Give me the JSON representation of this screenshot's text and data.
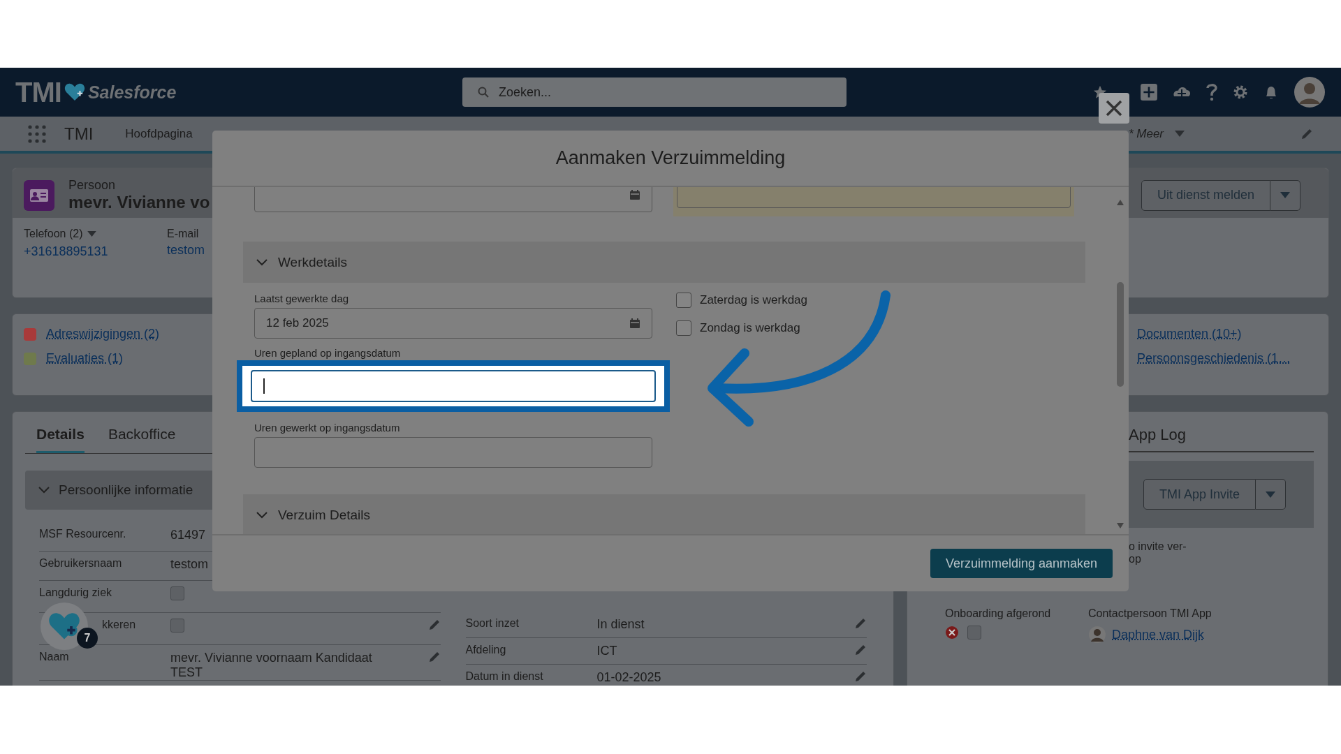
{
  "header": {
    "logo": "TMI",
    "brand": "Salesforce",
    "search": {
      "placeholder": "Zoeken..."
    }
  },
  "nav": {
    "app_name": "TMI",
    "items": [
      {
        "label": "Hoofdpagina"
      }
    ],
    "more": "* Meer"
  },
  "record": {
    "type": "Persoon",
    "name": "mevr. Vivianne vo",
    "phone_label": "Telefoon (2)",
    "phone": "+31618895131",
    "email_label": "E-mail",
    "email": "testom",
    "action": "Uit dienst melden"
  },
  "related_left": [
    {
      "label": "Adreswijzigingen (2)",
      "color": "#a83a3a"
    },
    {
      "label": "Evaluaties (1)",
      "color": "#6f7a4c"
    }
  ],
  "related_right": [
    {
      "label": "Documenten (10+)"
    },
    {
      "label": "Persoonsgeschiedenis (1…"
    }
  ],
  "tabs": [
    {
      "label": "Details",
      "selected": true
    },
    {
      "label": "Backoffice",
      "selected": false
    }
  ],
  "section": {
    "title": "Persoonlijke informatie",
    "expanded": true
  },
  "personal_fields": [
    {
      "kind": "text",
      "label": "MSF Resourcenr.",
      "value": "61497"
    },
    {
      "kind": "text",
      "label": "Gebruikersnaam",
      "value": "testom"
    },
    {
      "kind": "checkbox",
      "label": "Langdurig ziek",
      "checked": false
    },
    {
      "kind": "checkbox",
      "label": "kkeren",
      "checked": false
    },
    {
      "kind": "text",
      "label": "Naam",
      "value": "mevr. Vivianne voornaam Kandidaat TEST"
    }
  ],
  "work_fields": [
    {
      "label": "Soort inzet",
      "value": "In dienst"
    },
    {
      "label": "Afdeling",
      "value": "ICT"
    },
    {
      "label": "Datum in dienst",
      "value": "01-02-2025"
    }
  ],
  "app_log": {
    "title": "App Log",
    "button": "TMI App Invite",
    "note": "o invite ver-\nop",
    "onboarding_label": "Onboarding afgerond",
    "onboarding_checked": false,
    "contact_label": "Contactpersoon TMI App",
    "contact": "Daphne van Dijk"
  },
  "fab": {
    "badge": "7"
  },
  "modal": {
    "title": "Aanmaken Verzuimmelding",
    "work_section": {
      "title": "Werkdetails",
      "expanded": true
    },
    "last_day": {
      "label": "Laatst gewerkte dag",
      "value": "12 feb 2025"
    },
    "weekend": [
      {
        "label": "Zaterdag is werkdag",
        "checked": false
      },
      {
        "label": "Zondag is werkdag",
        "checked": false
      }
    ],
    "hours_planned": {
      "label": "Uren gepland op ingangsdatum",
      "focused": true,
      "highlighted": true
    },
    "hours_worked": {
      "label": "Uren gewerkt op ingangsdatum"
    },
    "absence_section": {
      "title": "Verzuim Details",
      "expanded": true
    },
    "submit": "Verzuimmelding aanmaken"
  }
}
